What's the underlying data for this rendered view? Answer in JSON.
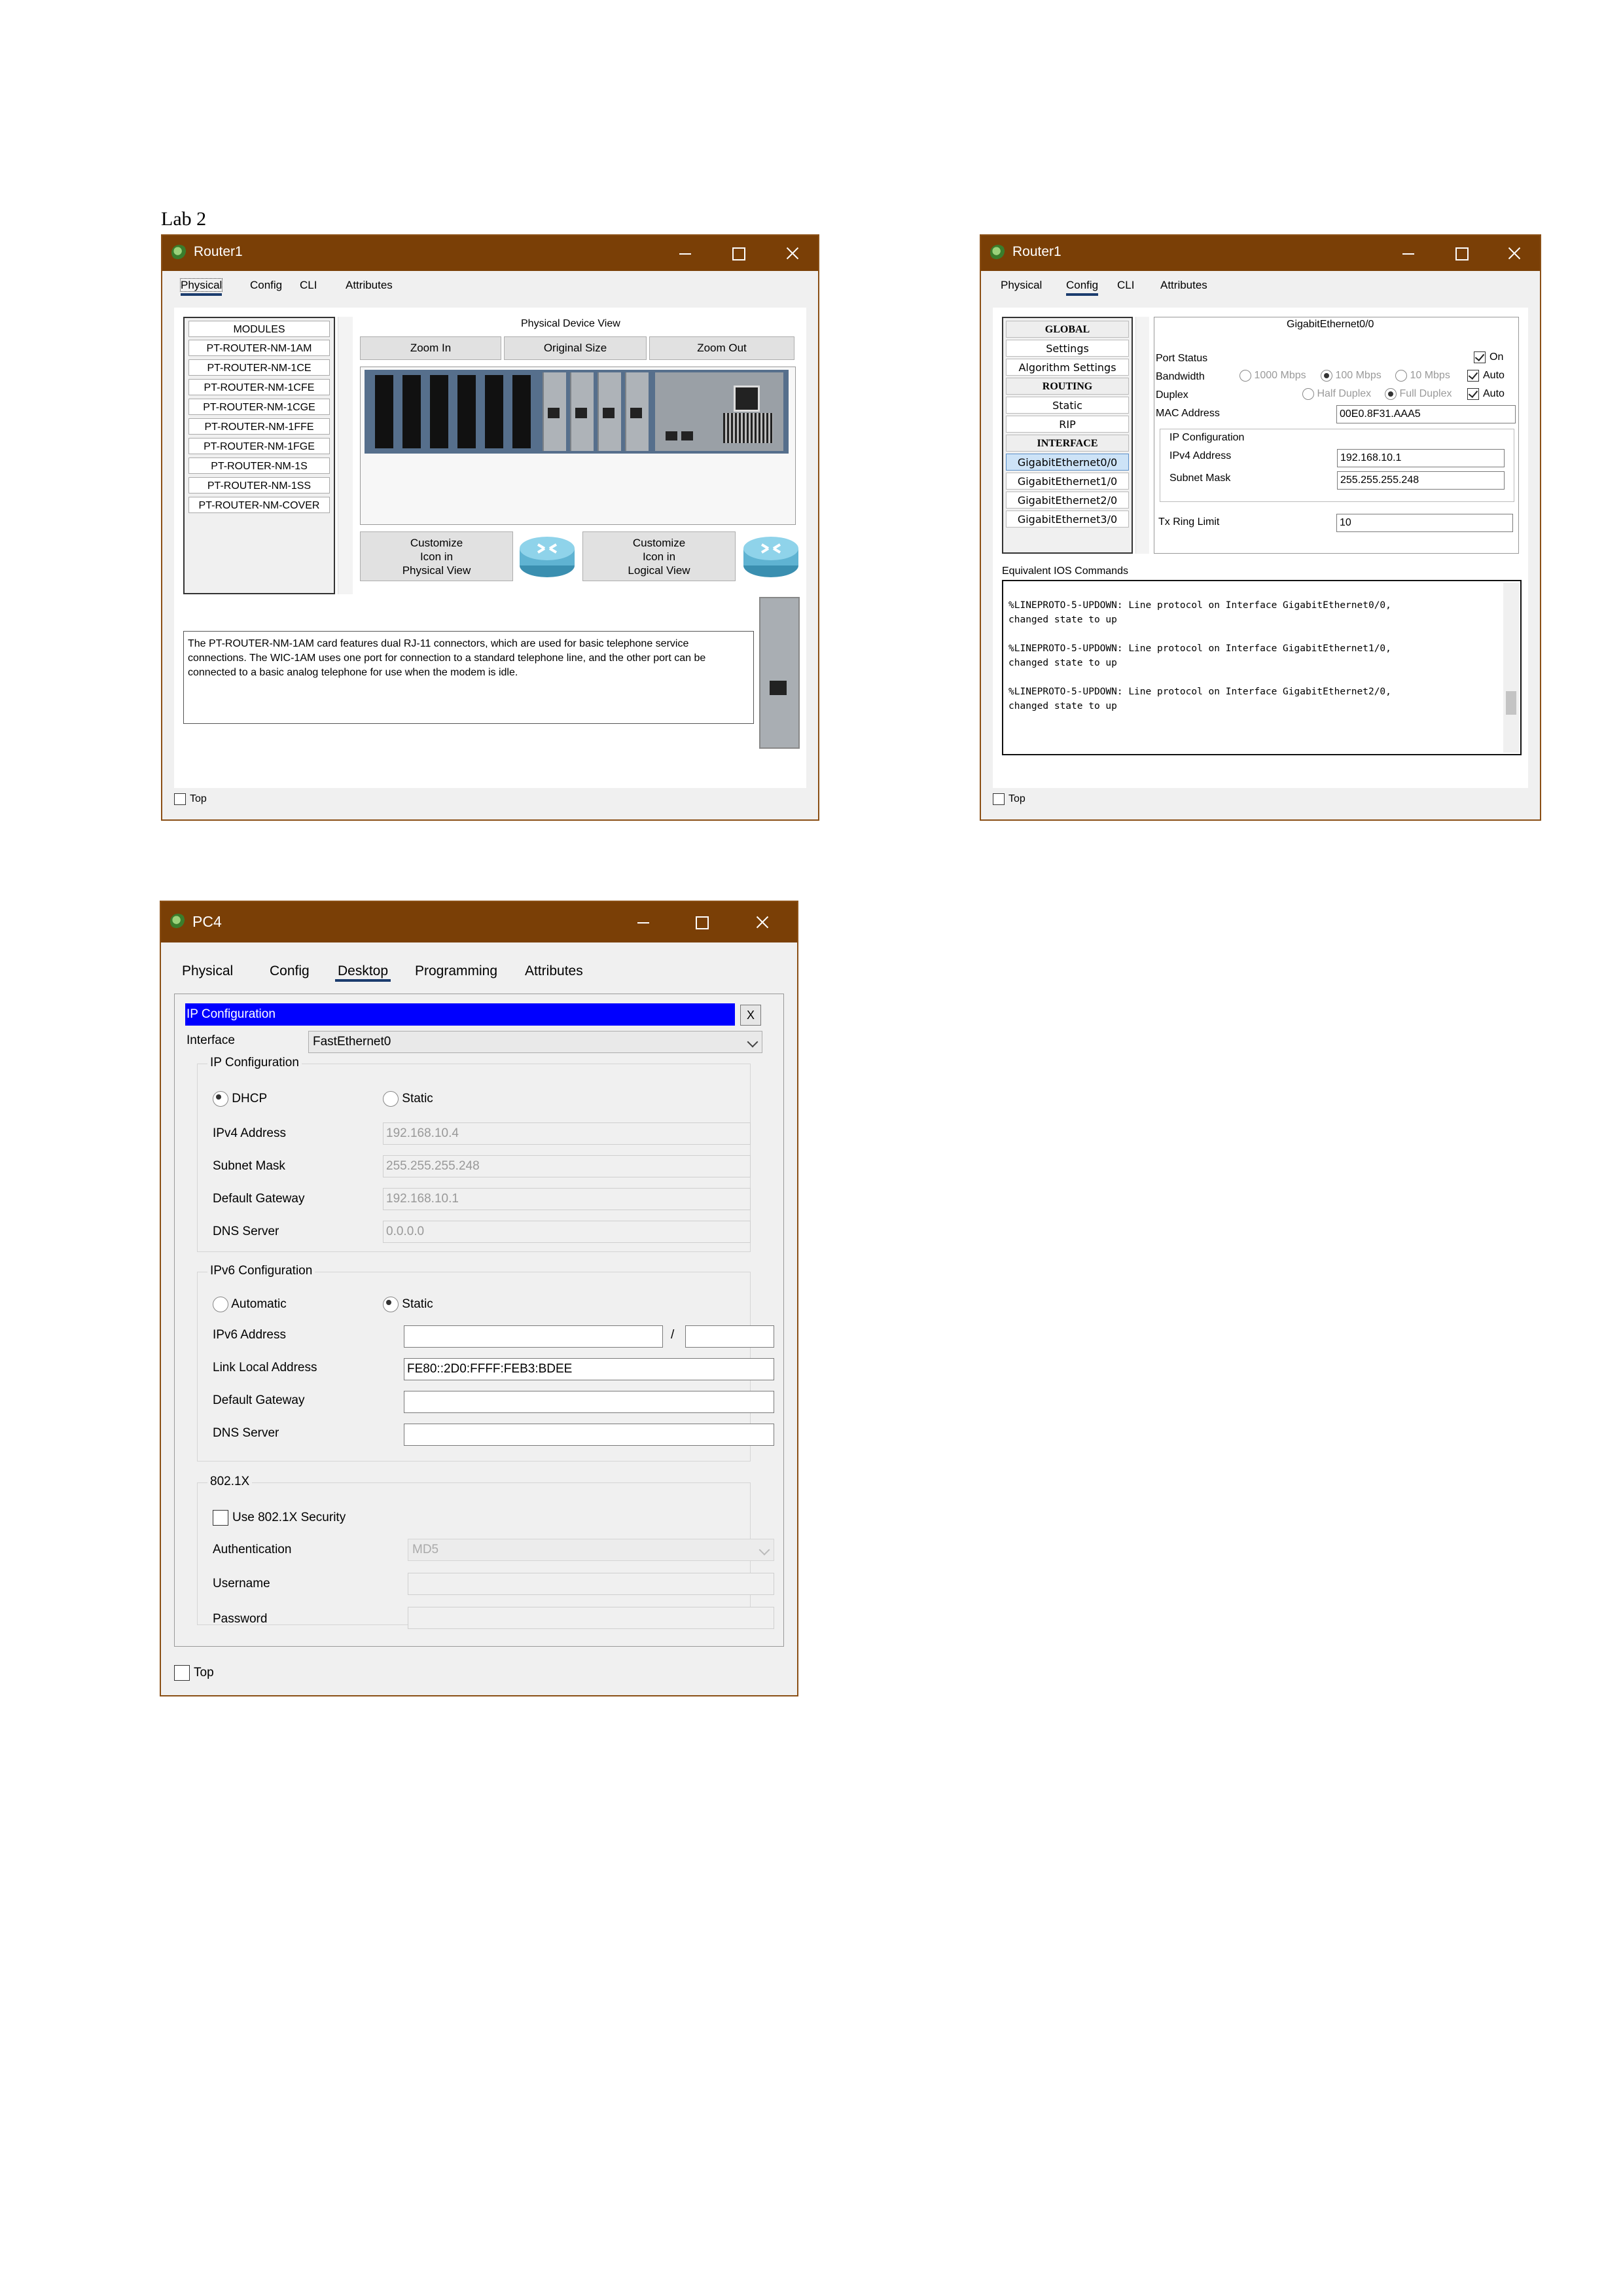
{
  "doc_title": "Lab 2",
  "router_physical": {
    "window_title": "Router1",
    "tabs": [
      "Physical",
      "Config",
      "CLI",
      "Attributes"
    ],
    "active_tab": "Physical",
    "modules_header": "MODULES",
    "modules": [
      "PT-ROUTER-NM-1AM",
      "PT-ROUTER-NM-1CE",
      "PT-ROUTER-NM-1CFE",
      "PT-ROUTER-NM-1CGE",
      "PT-ROUTER-NM-1FFE",
      "PT-ROUTER-NM-1FGE",
      "PT-ROUTER-NM-1S",
      "PT-ROUTER-NM-1SS",
      "PT-ROUTER-NM-COVER"
    ],
    "view_title": "Physical Device View",
    "zoom_in": "Zoom In",
    "original_size": "Original Size",
    "zoom_out": "Zoom Out",
    "customize_physical": [
      "Customize",
      "Icon in",
      "Physical View"
    ],
    "customize_logical": [
      "Customize",
      "Icon in",
      "Logical View"
    ],
    "description": "The PT-ROUTER-NM-1AM card features dual RJ-11 connectors, which are used for basic telephone service connections. The WIC-1AM uses one port for connection to a standard telephone line, and the other port can be connected to a basic analog telephone for use when the modem is idle.",
    "top_label": "Top"
  },
  "router_config": {
    "window_title": "Router1",
    "tabs": [
      "Physical",
      "Config",
      "CLI",
      "Attributes"
    ],
    "active_tab": "Config",
    "side_items": [
      {
        "label": "GLOBAL",
        "header": true
      },
      {
        "label": "Settings"
      },
      {
        "label": "Algorithm Settings"
      },
      {
        "label": "ROUTING",
        "header": true
      },
      {
        "label": "Static"
      },
      {
        "label": "RIP"
      },
      {
        "label": "INTERFACE",
        "header": true
      },
      {
        "label": "GigabitEthernet0/0",
        "selected": true
      },
      {
        "label": "GigabitEthernet1/0"
      },
      {
        "label": "GigabitEthernet2/0"
      },
      {
        "label": "GigabitEthernet3/0"
      }
    ],
    "panel_title": "GigabitEthernet0/0",
    "port_status_label": "Port Status",
    "port_status_on": "On",
    "bandwidth_label": "Bandwidth",
    "bw_1000": "1000 Mbps",
    "bw_100": "100 Mbps",
    "bw_10": "10 Mbps",
    "auto_label": "Auto",
    "duplex_label": "Duplex",
    "half_duplex": "Half Duplex",
    "full_duplex": "Full Duplex",
    "mac_label": "MAC Address",
    "mac_value": "00E0.8F31.AAA5",
    "ipconf_label": "IP Configuration",
    "ipv4_label": "IPv4 Address",
    "ipv4_value": "192.168.10.1",
    "mask_label": "Subnet Mask",
    "mask_value": "255.255.255.248",
    "tx_label": "Tx Ring Limit",
    "tx_value": "10",
    "ios_label": "Equivalent IOS Commands",
    "console_text": "%LINEPROTO-5-UPDOWN: Line protocol on Interface GigabitEthernet0/0,\nchanged state to up\n\n%LINEPROTO-5-UPDOWN: Line protocol on Interface GigabitEthernet1/0,\nchanged state to up\n\n%LINEPROTO-5-UPDOWN: Line protocol on Interface GigabitEthernet2/0,\nchanged state to up",
    "top_label": "Top"
  },
  "pc4": {
    "window_title": "PC4",
    "tabs": [
      "Physical",
      "Config",
      "Desktop",
      "Programming",
      "Attributes"
    ],
    "active_tab": "Desktop",
    "ipconf_bar": "IP Configuration",
    "close_x": "X",
    "interface_label": "Interface",
    "interface_value": "FastEthernet0",
    "ipv4_group": "IP Configuration",
    "dhcp": "DHCP",
    "static": "Static",
    "ipv4_label": "IPv4 Address",
    "ipv4_value": "192.168.10.4",
    "mask_label": "Subnet Mask",
    "mask_value": "255.255.255.248",
    "gw_label": "Default Gateway",
    "gw_value": "192.168.10.1",
    "dns_label": "DNS Server",
    "dns_value": "0.0.0.0",
    "ipv6_group": "IPv6 Configuration",
    "automatic": "Automatic",
    "static6": "Static",
    "ipv6_label": "IPv6 Address",
    "ipv6_slash": "/",
    "link_local_label": "Link Local Address",
    "link_local_value": "FE80::2D0:FFFF:FEB3:BDEE",
    "gw6_label": "Default Gateway",
    "dns6_label": "DNS Server",
    "dot1x_group": "802.1X",
    "use_dot1x": "Use 802.1X Security",
    "auth_label": "Authentication",
    "auth_value": "MD5",
    "user_label": "Username",
    "pass_label": "Password",
    "top_label": "Top"
  }
}
